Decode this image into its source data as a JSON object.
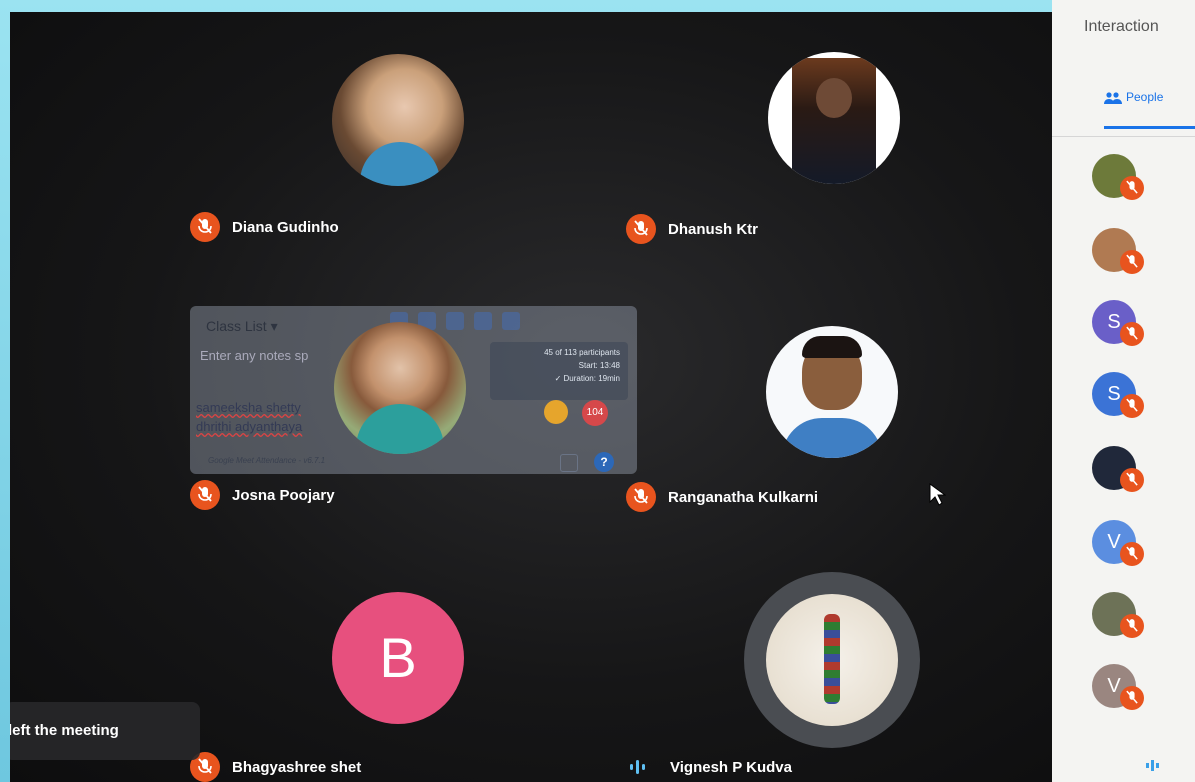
{
  "side_panel": {
    "title": "Interaction",
    "tab_label": "People",
    "people": [
      {
        "initial": "",
        "color": "#6d7a3a",
        "kind": "photo"
      },
      {
        "initial": "",
        "color": "#b07a52",
        "kind": "photo"
      },
      {
        "initial": "S",
        "color": "#6a5fc8",
        "kind": "letter"
      },
      {
        "initial": "S",
        "color": "#3b73d6",
        "kind": "letter"
      },
      {
        "initial": "",
        "color": "#20283a",
        "kind": "photo"
      },
      {
        "initial": "V",
        "color": "#5b8ee0",
        "kind": "letter"
      },
      {
        "initial": "",
        "color": "#6d7257",
        "kind": "photo"
      },
      {
        "initial": "V",
        "color": "#9a8680",
        "kind": "letter"
      }
    ]
  },
  "tiles": [
    {
      "name": "Diana Gudinho",
      "muted": true
    },
    {
      "name": "Dhanush Ktr",
      "muted": true
    },
    {
      "name": "Josna Poojary",
      "muted": true
    },
    {
      "name": "Ranganatha Kulkarni",
      "muted": true
    },
    {
      "name": "Bhagyashree shet",
      "muted": true,
      "initial": "B"
    },
    {
      "name": "Vignesh P Kudva",
      "muted": false
    }
  ],
  "attendance_overlay": {
    "header": "Class List",
    "notes_placeholder": "Enter any notes sp",
    "stats": [
      "45 of 113 participants",
      "Start: 13:48",
      "✓ Duration: 19min"
    ],
    "students": [
      "sameeksha shetty",
      "dhrithi adyanthaya"
    ],
    "count_badge": "104",
    "footer": "Google Meet Attendance - v6.7.1",
    "help": "?"
  },
  "left_notice": "left the meeting",
  "colors": {
    "mute": "#e8541e",
    "accent": "#1a73e8",
    "b_avatar": "#e7507e"
  }
}
